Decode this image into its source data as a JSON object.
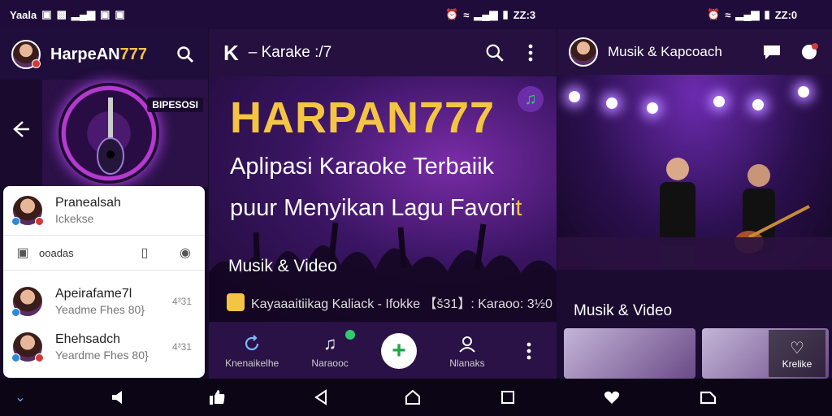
{
  "status_left": {
    "carrier": "Yaala",
    "icons": [
      "sim-icon",
      "notification-icon",
      "signal-icon",
      "message-icon",
      "photo-icon"
    ]
  },
  "status_mid": {
    "time": "ZZ:3"
  },
  "status_right": {
    "time": "ZZ:0"
  },
  "left": {
    "title_white": "HarpeAN",
    "title_gold": "777",
    "hero_label": "BIPESOSI",
    "card": {
      "contacts": [
        {
          "name": "Pranealsah",
          "sub": "Ickekse",
          "meta": ""
        },
        {
          "name": "Apeirafame7l",
          "sub": "Yeadme Fhes 80}",
          "meta": "4³31"
        },
        {
          "name": "Ehehsadch",
          "sub": "Yeardme Fhes 80}",
          "meta": "4³31"
        }
      ],
      "action_label": "ooadas"
    }
  },
  "middle": {
    "logo": "K",
    "title": "– Karake :/7",
    "brand": "HARPAN777",
    "tagline_1": "Aplipasi Karaoke Terbaiik",
    "tagline_2": "puur Menyikan Lagu Favori",
    "tagline_2_suffix": "t",
    "mv_label": "Musik & Video",
    "info_line": "Kayaaaitiikag Kaliack - Ifokke 【š31】: Karaoo: 3½0",
    "nav": [
      {
        "label": "Knenaikelhe",
        "icon": "refresh-icon"
      },
      {
        "label": "Naraooc",
        "icon": "music-note-icon"
      },
      {
        "label": "",
        "icon": "add-icon"
      },
      {
        "label": "Nlanaks",
        "icon": "profile-icon"
      }
    ]
  },
  "right": {
    "title": "Musik & Kapcoach",
    "mv_label": "Musik & Video",
    "thumb_label": "Krelike"
  },
  "colors": {
    "accent": "#f4c542",
    "bg": "#1a0b2e",
    "fab_plus": "#1fa34a"
  }
}
